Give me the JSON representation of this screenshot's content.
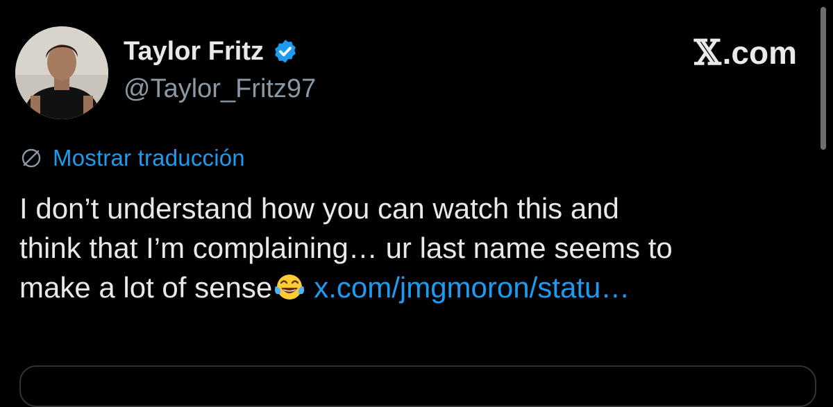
{
  "author": {
    "display_name": "Taylor Fritz",
    "handle": "@Taylor_Fritz97",
    "verified": true,
    "verified_badge_color": "#1d9bf0"
  },
  "header": {
    "site_x": "𝕏",
    "site_suffix": ".com"
  },
  "translate": {
    "icon": "globe-icon",
    "label": "Mostrar traducción"
  },
  "tweet": {
    "line1": "I don’t understand how you can watch this and",
    "line2": "think that I’m complaining… ur last name seems to",
    "line3_text": "make a lot of sense",
    "line3_emoji": "face-with-tears-of-joy-icon",
    "link": "x.com/jmgmoron/statu…"
  },
  "colors": {
    "background": "#000000",
    "text_primary": "#e7e9ea",
    "text_secondary": "#8b98a5",
    "link": "#1d9bf0",
    "border": "#2f3336"
  }
}
